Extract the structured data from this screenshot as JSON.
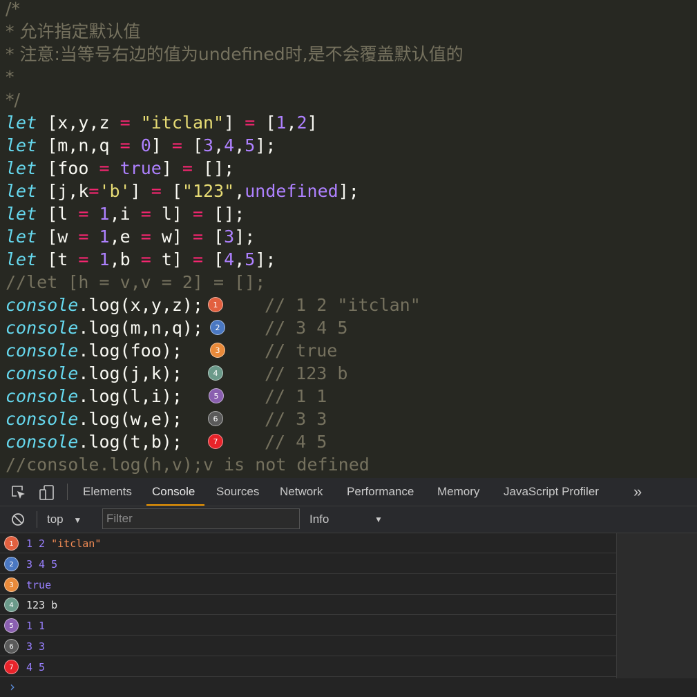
{
  "editor": {
    "comment_lines": [
      "/*",
      "* 允许指定默认值",
      "* 注意:当等号右边的值为undefined时,是不会覆盖默认值的",
      "*",
      "*/"
    ],
    "let_lines": [
      [
        [
          "kw",
          "let"
        ],
        [
          "id",
          " [x,y,z "
        ],
        [
          "op",
          "="
        ],
        [
          "id",
          " "
        ],
        [
          "str",
          "\"itclan\""
        ],
        [
          "id",
          "] "
        ],
        [
          "op",
          "="
        ],
        [
          "id",
          " ["
        ],
        [
          "num",
          "1"
        ],
        [
          "id",
          ","
        ],
        [
          "num",
          "2"
        ],
        [
          "id",
          "]"
        ]
      ],
      [
        [
          "kw",
          "let"
        ],
        [
          "id",
          " [m,n,q "
        ],
        [
          "op",
          "="
        ],
        [
          "id",
          " "
        ],
        [
          "num",
          "0"
        ],
        [
          "id",
          "] "
        ],
        [
          "op",
          "="
        ],
        [
          "id",
          " ["
        ],
        [
          "num",
          "3"
        ],
        [
          "id",
          ","
        ],
        [
          "num",
          "4"
        ],
        [
          "id",
          ","
        ],
        [
          "num",
          "5"
        ],
        [
          "id",
          "];"
        ]
      ],
      [
        [
          "kw",
          "let"
        ],
        [
          "id",
          " [foo "
        ],
        [
          "op",
          "="
        ],
        [
          "id",
          " "
        ],
        [
          "num",
          "true"
        ],
        [
          "id",
          "] "
        ],
        [
          "op",
          "="
        ],
        [
          "id",
          " [];"
        ]
      ],
      [
        [
          "kw",
          "let"
        ],
        [
          "id",
          " [j,k"
        ],
        [
          "op",
          "="
        ],
        [
          "str",
          "'b'"
        ],
        [
          "id",
          "] "
        ],
        [
          "op",
          "="
        ],
        [
          "id",
          " ["
        ],
        [
          "str",
          "\"123\""
        ],
        [
          "id",
          ","
        ],
        [
          "num",
          "undefined"
        ],
        [
          "id",
          "];"
        ]
      ],
      [
        [
          "kw",
          "let"
        ],
        [
          "id",
          " [l "
        ],
        [
          "op",
          "="
        ],
        [
          "id",
          " "
        ],
        [
          "num",
          "1"
        ],
        [
          "id",
          ",i "
        ],
        [
          "op",
          "="
        ],
        [
          "id",
          " l] "
        ],
        [
          "op",
          "="
        ],
        [
          "id",
          " [];"
        ]
      ],
      [
        [
          "kw",
          "let"
        ],
        [
          "id",
          " [w "
        ],
        [
          "op",
          "="
        ],
        [
          "id",
          " "
        ],
        [
          "num",
          "1"
        ],
        [
          "id",
          ",e "
        ],
        [
          "op",
          "="
        ],
        [
          "id",
          " w] "
        ],
        [
          "op",
          "="
        ],
        [
          "id",
          " ["
        ],
        [
          "num",
          "3"
        ],
        [
          "id",
          "];"
        ]
      ],
      [
        [
          "kw",
          "let"
        ],
        [
          "id",
          " [t "
        ],
        [
          "op",
          "="
        ],
        [
          "id",
          " "
        ],
        [
          "num",
          "1"
        ],
        [
          "id",
          ",b "
        ],
        [
          "op",
          "="
        ],
        [
          "id",
          " t] "
        ],
        [
          "op",
          "="
        ],
        [
          "id",
          " ["
        ],
        [
          "num",
          "4"
        ],
        [
          "id",
          ","
        ],
        [
          "num",
          "5"
        ],
        [
          "id",
          "];"
        ]
      ]
    ],
    "commented_let": "//let [h = v,v = 2] = [];",
    "console_kw": "console",
    "console_args": [
      ".log(x,y,z);",
      ".log(m,n,q);",
      ".log(foo);",
      ".log(j,k);",
      ".log(l,i);",
      ".log(w,e);",
      ".log(t,b);"
    ],
    "inline_comments": [
      "// 1 2 \"itclan\"",
      "// 3 4 5",
      "// true",
      "// 123 b",
      "// 1 1",
      "// 3 3",
      "// 4 5"
    ],
    "last_line": "//console.log(h,v);v is not defined"
  },
  "markers": [
    {
      "n": "1",
      "color": "#e2603f"
    },
    {
      "n": "2",
      "color": "#4a78c2"
    },
    {
      "n": "3",
      "color": "#e98a3a"
    },
    {
      "n": "4",
      "color": "#6b9a8a"
    },
    {
      "n": "5",
      "color": "#8a5fb0"
    },
    {
      "n": "6",
      "color": "#5a5a5a"
    },
    {
      "n": "7",
      "color": "#e8232a"
    }
  ],
  "devtools": {
    "tabs": [
      "Elements",
      "Console",
      "Sources",
      "Network",
      "Performance",
      "Memory",
      "JavaScript Profiler"
    ],
    "active_tab": "Console",
    "more_glyph": "»",
    "context_label": "top",
    "filter_placeholder": "Filter",
    "level_label": "Info",
    "prompt": "›"
  },
  "console_logs": [
    [
      [
        "n",
        "1 2 "
      ],
      [
        "s",
        "\"itclan\""
      ]
    ],
    [
      [
        "n",
        "3 4 5"
      ]
    ],
    [
      [
        "n",
        "true"
      ]
    ],
    [
      [
        "p",
        "123 b"
      ]
    ],
    [
      [
        "n",
        "1 1"
      ]
    ],
    [
      [
        "n",
        "3 3"
      ]
    ],
    [
      [
        "n",
        "4 5"
      ]
    ]
  ]
}
